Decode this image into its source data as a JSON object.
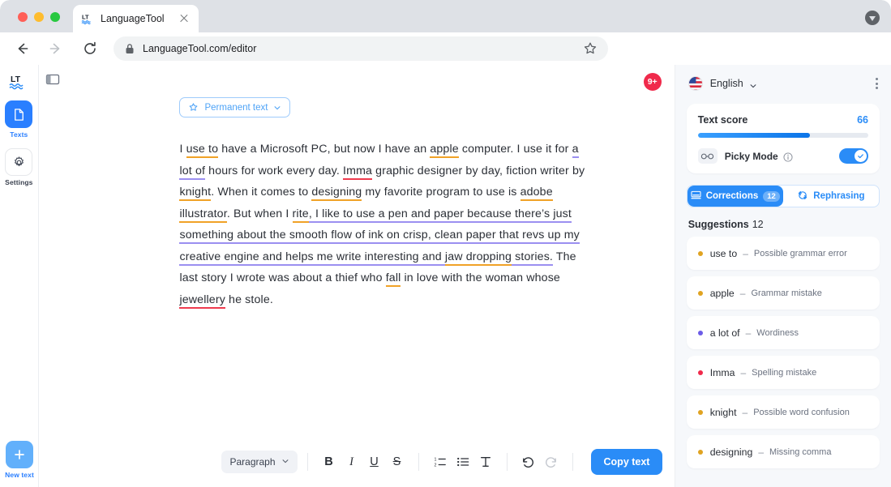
{
  "browser": {
    "tab": {
      "title": "LanguageTool",
      "favicon_icon": "lt-logo-icon",
      "close_icon": "close-icon"
    },
    "back_icon": "back-arrow-icon",
    "forward_icon": "forward-arrow-icon",
    "reload_icon": "reload-icon",
    "lock_icon": "lock-icon",
    "url": "LanguageTool.com/editor",
    "bookmark_icon": "star-icon",
    "menu_icon": "chevron-down-circle-icon"
  },
  "rail": {
    "logo_icon": "lt-logo-icon",
    "items": [
      {
        "label": "Texts",
        "icon": "document-icon",
        "active": true
      },
      {
        "label": "Settings",
        "icon": "gear-icon",
        "active": false
      }
    ],
    "new_text": {
      "label": "New text",
      "icon": "plus-icon"
    }
  },
  "panel_toggle_icon": "sidebar-panel-icon",
  "editor": {
    "chip": {
      "label": "Permanent text",
      "star_icon": "star-outline-icon",
      "chevron_icon": "chevron-down-icon"
    },
    "paragraphs": [
      [
        {
          "t": "I ",
          "m": "none"
        },
        {
          "t": "use to",
          "m": "orange"
        },
        {
          "t": " have a Microsoft PC, but now I have an ",
          "m": "none"
        },
        {
          "t": "apple",
          "m": "orange"
        },
        {
          "t": " computer. I use it for ",
          "m": "none"
        },
        {
          "t": "a lot of",
          "m": "purple"
        },
        {
          "t": " hours for work every day. ",
          "m": "none"
        },
        {
          "t": "Imma",
          "m": "red"
        },
        {
          "t": " graphic designer by day, fiction writer by ",
          "m": "none"
        },
        {
          "t": "knight",
          "m": "orange"
        },
        {
          "t": ". When it comes to ",
          "m": "none"
        },
        {
          "t": "designing",
          "m": "orange"
        },
        {
          "t": " my favorite program to use is ",
          "m": "none"
        },
        {
          "t": "adobe illustrator",
          "m": "orange"
        },
        {
          "t": ". But when I ",
          "m": "none"
        },
        {
          "t": "rite",
          "m": "orange"
        },
        {
          "t": ", I like to use a pen and paper because there’s just something about the smooth flow of ink on crisp, clean paper that revs up my creative engine and helps me write interesting and ",
          "m": "purple"
        },
        {
          "t": "jaw dropping",
          "m": "orange"
        },
        {
          "t": " stories.",
          "m": "purple"
        },
        {
          "t": " The last story I wrote was about a thief who ",
          "m": "none"
        },
        {
          "t": "fall",
          "m": "orange"
        },
        {
          "t": " in love with the woman whose ",
          "m": "none"
        },
        {
          "t": "jewellery",
          "m": "red"
        },
        {
          "t": " he stole.",
          "m": "none"
        }
      ]
    ],
    "toolbar": {
      "paragraph_label": "Paragraph",
      "paragraph_chevron_icon": "chevron-down-icon",
      "bold_label": "B",
      "italic_label": "I",
      "underline_label": "U",
      "strikethrough_label": "S",
      "ordered_list_icon": "ordered-list-icon",
      "bullet_list_icon": "bullet-list-icon",
      "clear_format_icon": "clear-formatting-icon",
      "undo_icon": "undo-icon",
      "redo_icon": "redo-icon",
      "copy_label": "Copy text"
    }
  },
  "notification_badge": "9+",
  "sidebar": {
    "language": {
      "label": "English",
      "flag_icon": "us-flag-icon",
      "chevron_icon": "chevron-down-icon"
    },
    "menu_icon": "kebab-menu-icon",
    "text_score": {
      "label": "Text score",
      "value": "66",
      "percent": 66
    },
    "picky_mode": {
      "label": "Picky Mode",
      "icon": "glasses-icon",
      "info_icon": "info-icon",
      "enabled": true,
      "toggle_icon": "check-icon"
    },
    "tabs": [
      {
        "label": "Corrections",
        "count": "12",
        "icon": "corrections-icon",
        "active": true
      },
      {
        "label": "Rephrasing",
        "count": "",
        "icon": "rephrasing-icon",
        "active": false
      }
    ],
    "suggestions_header": {
      "label": "Suggestions",
      "count": "12"
    },
    "suggestions": [
      {
        "word": "use to",
        "dash": "–",
        "category": "Possible grammar error",
        "color": "#e0a321"
      },
      {
        "word": "apple",
        "dash": "–",
        "category": "Grammar mistake",
        "color": "#e0a321"
      },
      {
        "word": "a lot of",
        "dash": "–",
        "category": "Wordiness",
        "color": "#6c5ce7"
      },
      {
        "word": "Imma",
        "dash": "–",
        "category": "Spelling mistake",
        "color": "#f02a4b"
      },
      {
        "word": "knight",
        "dash": "–",
        "category": "Possible word confusion",
        "color": "#e0a321"
      },
      {
        "word": "designing",
        "dash": "–",
        "category": "Missing comma",
        "color": "#e0a321"
      }
    ]
  },
  "colors": {
    "accent": "#2a8cf7",
    "grammar_orange": "#f0a227",
    "spelling_red": "#ef3b4e",
    "style_purple": "#9b8ff0",
    "sidebar_bg": "#f6f8fb"
  }
}
